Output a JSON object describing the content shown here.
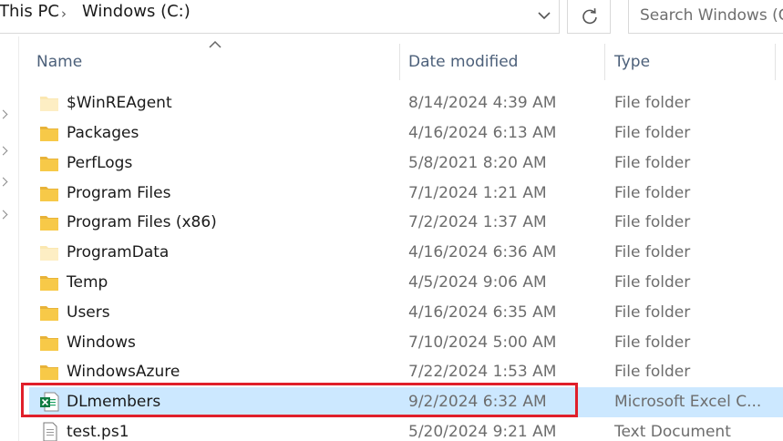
{
  "breadcrumb": {
    "items": [
      "This PC",
      "Windows (C:)"
    ],
    "separator": "›"
  },
  "search": {
    "placeholder": "Search Windows (C:)"
  },
  "columns": {
    "name": "Name",
    "date": "Date modified",
    "type": "Type"
  },
  "files": [
    {
      "name": "$WinREAgent",
      "date": "8/14/2024 4:39 AM",
      "type": "File folder",
      "icon": "folder-icon-faded"
    },
    {
      "name": "Packages",
      "date": "4/16/2024 6:13 AM",
      "type": "File folder",
      "icon": "folder-icon"
    },
    {
      "name": "PerfLogs",
      "date": "5/8/2021 8:20 AM",
      "type": "File folder",
      "icon": "folder-icon"
    },
    {
      "name": "Program Files",
      "date": "7/1/2024 1:21 AM",
      "type": "File folder",
      "icon": "folder-icon"
    },
    {
      "name": "Program Files (x86)",
      "date": "7/2/2024 1:37 AM",
      "type": "File folder",
      "icon": "folder-icon"
    },
    {
      "name": "ProgramData",
      "date": "4/16/2024 6:36 AM",
      "type": "File folder",
      "icon": "folder-icon-faded"
    },
    {
      "name": "Temp",
      "date": "4/5/2024 9:06 AM",
      "type": "File folder",
      "icon": "folder-icon"
    },
    {
      "name": "Users",
      "date": "4/16/2024 6:35 AM",
      "type": "File folder",
      "icon": "folder-icon"
    },
    {
      "name": "Windows",
      "date": "7/10/2024 5:00 AM",
      "type": "File folder",
      "icon": "folder-icon"
    },
    {
      "name": "WindowsAzure",
      "date": "7/22/2024 1:53 AM",
      "type": "File folder",
      "icon": "folder-icon"
    },
    {
      "name": "DLmembers",
      "date": "9/2/2024 6:32 AM",
      "type": "Microsoft Excel C...",
      "icon": "excel-csv-icon",
      "selected": true
    },
    {
      "name": "test.ps1",
      "date": "5/20/2024 9:21 AM",
      "type": "Text Document",
      "icon": "text-file-icon"
    }
  ],
  "nav_fragments": [
    ":",
    ":"
  ],
  "colors": {
    "selection": "#cce8ff",
    "highlight": "#e01f2a",
    "folder": "#f7c948",
    "header_text": "#4c607a"
  }
}
